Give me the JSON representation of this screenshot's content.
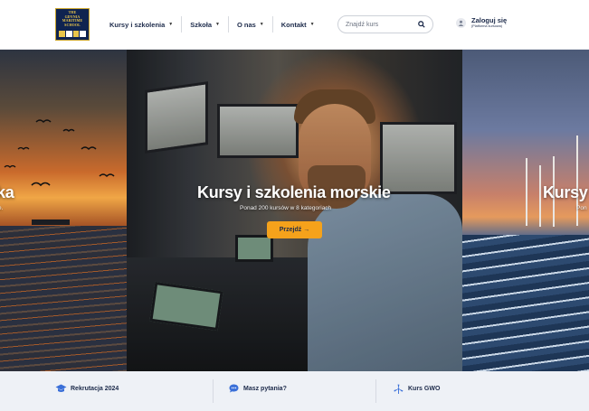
{
  "logo": {
    "text": [
      "THE",
      "GDYNIA",
      "MARITIME",
      "SCHOOL"
    ]
  },
  "nav": [
    {
      "label": "Kursy i szkolenia"
    },
    {
      "label": "Szkoła"
    },
    {
      "label": "O nas"
    },
    {
      "label": "Kontakt"
    }
  ],
  "search": {
    "placeholder": "Znajdź kurs"
  },
  "user": {
    "title": "Zaloguj się",
    "subtitle": "(Platforma kursowa)"
  },
  "hero": {
    "left_title": "ka",
    "left_sub": "e.",
    "center_title": "Kursy i szkolenia morskie",
    "center_sub": "Ponad 200 kursów w 8 kategoriach",
    "button": "Przejdź →",
    "right_title": "Kursy",
    "right_sub": "Pon"
  },
  "bottom_bar": [
    {
      "label": "Rekrutacja 2024",
      "icon": "graduation-cap-icon"
    },
    {
      "label": "Masz pytania?",
      "icon": "chat-bubble-icon"
    },
    {
      "label": "Kurs GWO",
      "icon": "wind-turbine-icon"
    }
  ],
  "colors": {
    "accent": "#f5a21b",
    "navy": "#1c2a4a",
    "bar_bg": "#eef1f6"
  }
}
